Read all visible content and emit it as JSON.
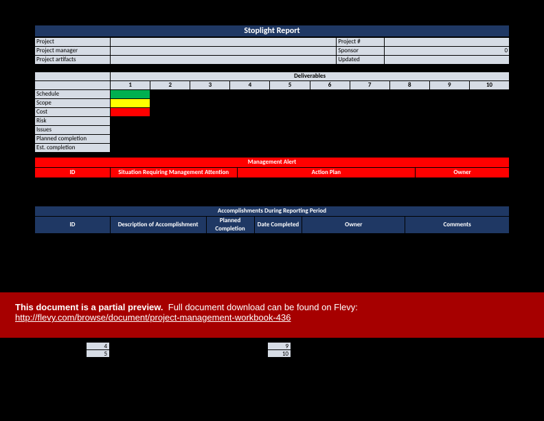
{
  "title": "Stoplight Report",
  "info": {
    "project_lbl": "Project",
    "projectnum_lbl": "Project #",
    "pm_lbl": "Project manager",
    "sponsor_lbl": "Sponsor",
    "sponsor_val": "0",
    "artifacts_lbl": "Project artifacts",
    "updated_lbl": "Updated"
  },
  "deliv": {
    "header": "Deliverables",
    "cols": [
      "1",
      "2",
      "3",
      "4",
      "5",
      "6",
      "7",
      "8",
      "9",
      "10"
    ],
    "rows": [
      "Schedule",
      "Scope",
      "Cost",
      "Risk",
      "Issues",
      "Planned completion",
      "Est. completion"
    ]
  },
  "alert": {
    "title": "Management Alert",
    "cols": [
      "ID",
      "Situation Requiring Management Attention",
      "Action Plan",
      "Owner"
    ]
  },
  "accomp": {
    "title": "Accomplishments During Reporting Period",
    "cols": [
      "ID",
      "Description of Accomplishment",
      "Planned Completion",
      "Date Completed",
      "Owner",
      "Comments"
    ]
  },
  "bottom": {
    "left": [
      "4",
      "5"
    ],
    "right": [
      "9",
      "10"
    ]
  },
  "banner": {
    "bold": "This document is a partial preview.",
    "rest": "Full document download can be found on Flevy:",
    "link": "http://flevy.com/browse/document/project-management-workbook-436"
  }
}
